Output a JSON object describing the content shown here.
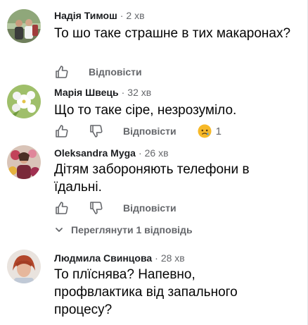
{
  "comments": [
    {
      "author": "Надія Тимош",
      "time": "2 хв",
      "text": "То шо таке страшне в тих макаронах?",
      "reply_label": "Відповісти"
    },
    {
      "author": "Марія Швець",
      "time": "32 хв",
      "text": "Що то таке сіре, незрозуміло.",
      "reply_label": "Відповісти",
      "reaction_icon": "sad-face-icon",
      "reaction_count": "1"
    },
    {
      "author": "Oleksandra Myga",
      "time": "26 хв",
      "text": "Дітям забороняють телефони в їдальні.",
      "reply_label": "Відповісти",
      "view_replies_label": "Переглянути 1 відповідь"
    },
    {
      "author": "Людмила Свинцова",
      "time": "28 хв",
      "text": "То плïснява? Напевно, профвлактика від запального процесу?"
    }
  ],
  "separator": "·",
  "colors": {
    "secondary_text": "#65676b",
    "primary_text": "#050505",
    "reaction_yellow": "#f7b928"
  }
}
